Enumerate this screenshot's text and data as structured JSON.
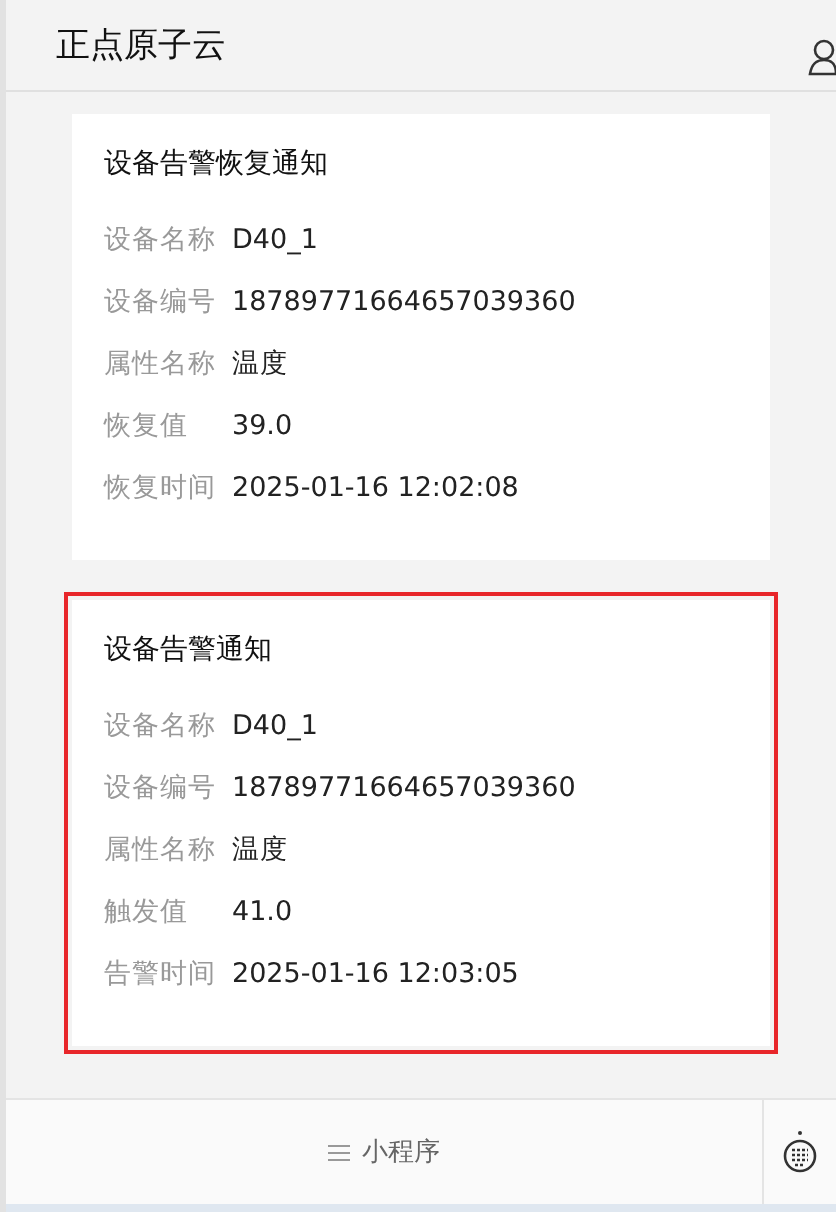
{
  "header": {
    "title": "正点原子云"
  },
  "cards": [
    {
      "title": "设备告警恢复通知",
      "highlighted": false,
      "fields": [
        {
          "label": "设备名称",
          "value": "D40_1"
        },
        {
          "label": "设备编号",
          "value": "18789771664657039360"
        },
        {
          "label": "属性名称",
          "value": "温度"
        },
        {
          "label": "恢复值",
          "value": "39.0"
        },
        {
          "label": "恢复时间",
          "value": "2025-01-16 12:02:08"
        }
      ]
    },
    {
      "title": "设备告警通知",
      "highlighted": true,
      "fields": [
        {
          "label": "设备名称",
          "value": "D40_1"
        },
        {
          "label": "设备编号",
          "value": "18789771664657039360"
        },
        {
          "label": "属性名称",
          "value": "温度"
        },
        {
          "label": "触发值",
          "value": "41.0"
        },
        {
          "label": "告警时间",
          "value": "2025-01-16 12:03:05"
        }
      ]
    }
  ],
  "footer": {
    "menu_label": "小程序"
  }
}
